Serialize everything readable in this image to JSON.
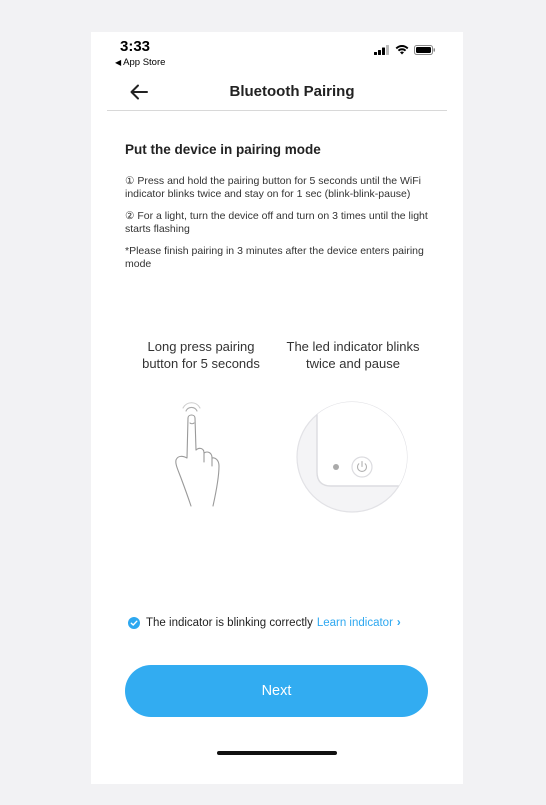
{
  "status_bar": {
    "time": "3:33",
    "back_label": "App Store"
  },
  "header": {
    "title": "Bluetooth Pairing"
  },
  "instructions": {
    "heading": "Put the device in pairing mode",
    "step1": "① Press and hold the pairing button for 5 seconds until the WiFi indicator blinks twice and stay on for 1 sec (blink-blink-pause)",
    "step2": "② For a light, turn the device off and turn on 3 times until the light starts flashing",
    "note": "*Please finish pairing in 3 minutes after the device enters pairing mode"
  },
  "illustrations": {
    "left_label": "Long press pairing button for 5 seconds",
    "right_label": "The led indicator blinks twice and pause"
  },
  "confirm": {
    "label": "The indicator is blinking correctly",
    "link": "Learn indicator",
    "checked": true
  },
  "footer": {
    "next_label": "Next"
  },
  "colors": {
    "accent": "#32acf1",
    "divider": "#d8d8d8"
  },
  "icons": [
    "back-arrow-icon",
    "signal-icon",
    "wifi-icon",
    "battery-icon",
    "check-circle-icon",
    "chevron-right-icon",
    "hand-press-icon",
    "power-icon"
  ]
}
